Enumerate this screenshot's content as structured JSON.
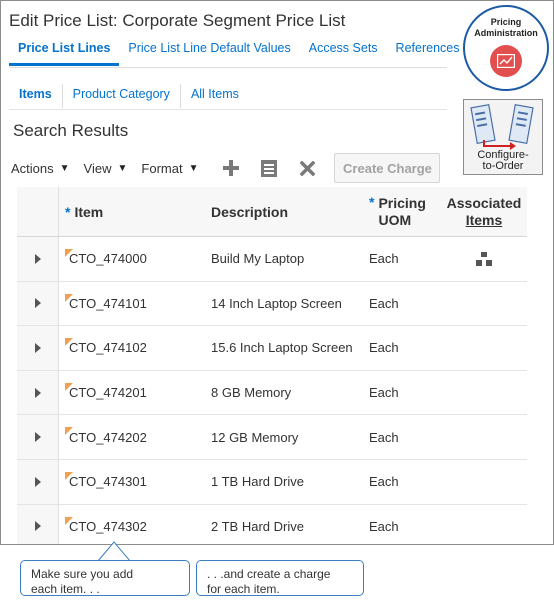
{
  "page": {
    "title": "Edit Price List: Corporate Segment Price List"
  },
  "main_tabs": [
    {
      "label": "Price List Lines",
      "active": true
    },
    {
      "label": "Price List Line Default Values",
      "active": false
    },
    {
      "label": "Access Sets",
      "active": false
    },
    {
      "label": "References",
      "active": false
    }
  ],
  "sub_tabs": [
    {
      "label": "Items",
      "active": true
    },
    {
      "label": "Product Category",
      "active": false
    },
    {
      "label": "All Items",
      "active": false
    }
  ],
  "section_title": "Search Results",
  "toolbar": {
    "actions_label": "Actions",
    "view_label": "View",
    "format_label": "Format",
    "add_icon": "plus-icon",
    "edit_icon": "edit-icon",
    "delete_icon": "delete-icon",
    "create_charge_label": "Create Charge"
  },
  "table": {
    "headers": {
      "item": "Item",
      "description": "Description",
      "pricing_uom_line1": "Pricing",
      "pricing_uom_line2": "UOM",
      "associated_line1": "Associated",
      "associated_line2": "Items",
      "required_marker": "*"
    },
    "rows": [
      {
        "item": "CTO_474000",
        "description": "Build My Laptop",
        "uom": "Each",
        "associated_icon": true
      },
      {
        "item": "CTO_474101",
        "description": "14 Inch Laptop Screen",
        "uom": "Each",
        "associated_icon": false
      },
      {
        "item": "CTO_474102",
        "description": "15.6 Inch Laptop Screen",
        "uom": "Each",
        "associated_icon": false
      },
      {
        "item": "CTO_474201",
        "description": "8 GB Memory",
        "uom": "Each",
        "associated_icon": false
      },
      {
        "item": "CTO_474202",
        "description": "12 GB Memory",
        "uom": "Each",
        "associated_icon": false
      },
      {
        "item": "CTO_474301",
        "description": "1 TB Hard Drive",
        "uom": "Each",
        "associated_icon": false
      },
      {
        "item": "CTO_474302",
        "description": "2 TB Hard Drive",
        "uom": "Each",
        "associated_icon": false
      }
    ]
  },
  "badges": {
    "pricing_admin_line1": "Pricing",
    "pricing_admin_line2": "Administration",
    "cto_line1": "Configure-",
    "cto_line2": "to-Order"
  },
  "callouts": {
    "left_line1": "Make sure you add",
    "left_line2": "each item. . .",
    "right_line1": ". . .and create a charge",
    "right_line2": "for each item."
  },
  "colors": {
    "link": "#0572ce",
    "flag": "#f0a050",
    "badge_red": "#e14f4f",
    "callout_border": "#3a7fc1"
  }
}
